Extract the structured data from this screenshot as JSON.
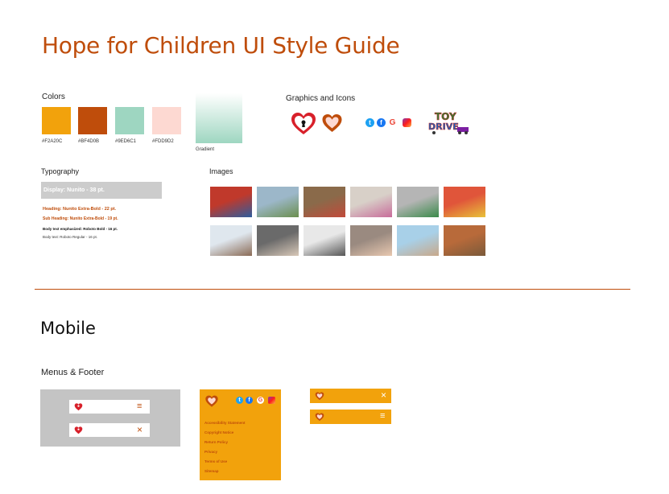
{
  "page": {
    "title": "Hope for Children UI Style Guide"
  },
  "colors": {
    "label": "Colors",
    "swatches": [
      {
        "hex": "#F2A20C",
        "code": "#F2A20C"
      },
      {
        "hex": "#BF4D0B",
        "code": "#BF4D0B"
      },
      {
        "hex": "#9ED6C1",
        "code": "#9ED6C1"
      },
      {
        "hex": "#FDD9D2",
        "code": "#FDD9D2"
      }
    ],
    "gradient_label": "Gradient",
    "gradient_from": "#ffffff",
    "gradient_to": "#9ED6C1"
  },
  "graphics": {
    "label": "Graphics and Icons",
    "icons": [
      "heart-keyhole-icon",
      "heart-outline-icon",
      "twitter-icon",
      "facebook-icon",
      "google-icon",
      "instagram-icon"
    ],
    "toy_drive_logo": "TOY DRIVE"
  },
  "typography": {
    "label": "Typography",
    "display": "Display: Nunito - 38 pt.",
    "heading": "Heading: Nunito Extra-Bold - 22 pt.",
    "subheading": "Sub Heading: Nunito Extra-Bold - 19 pt.",
    "body_emph": "Body text emphasized: Roboto Bold - 16 pt.",
    "body": "Body text: Roboto Regular - 16 pt."
  },
  "images": {
    "label": "Images",
    "tiles": [
      {
        "name": "child-superhero-photo",
        "colors": [
          "#c0392b",
          "#2d5c9e"
        ]
      },
      {
        "name": "family-field-photo",
        "colors": [
          "#9cb7c9",
          "#6b8f4e"
        ]
      },
      {
        "name": "volunteers-food-photo",
        "colors": [
          "#8a6a4a",
          "#c24a3a"
        ]
      },
      {
        "name": "child-playing-photo",
        "colors": [
          "#d8d0c8",
          "#c86c9a"
        ]
      },
      {
        "name": "child-mask-photo",
        "colors": [
          "#b5b5b5",
          "#3a8a4a"
        ]
      },
      {
        "name": "toys-pile-photo",
        "colors": [
          "#e0553a",
          "#e8c23a"
        ]
      },
      {
        "name": "handshake-photo",
        "colors": [
          "#dfe7ee",
          "#8a6a55"
        ]
      },
      {
        "name": "helping-hands-photo",
        "colors": [
          "#6a6a6a",
          "#d8c8b8"
        ]
      },
      {
        "name": "bw-children-photo",
        "colors": [
          "#e8e8e8",
          "#555555"
        ]
      },
      {
        "name": "open-hands-photo",
        "colors": [
          "#9a8a80",
          "#e8c8b0"
        ]
      },
      {
        "name": "kids-jumping-photo",
        "colors": [
          "#a8d0e8",
          "#c8a88a"
        ]
      },
      {
        "name": "autumn-kids-photo",
        "colors": [
          "#b86a3a",
          "#7a5a3a"
        ]
      }
    ]
  },
  "mobile": {
    "title": "Mobile",
    "menus_label": "Menus & Footer",
    "footer_links": [
      "Accessibility Statement",
      "Copyright Notice",
      "Return Policy",
      "Privacy",
      "Terms of Use",
      "Sitemap"
    ],
    "close_glyph": "×",
    "menu_glyph": "≡"
  }
}
